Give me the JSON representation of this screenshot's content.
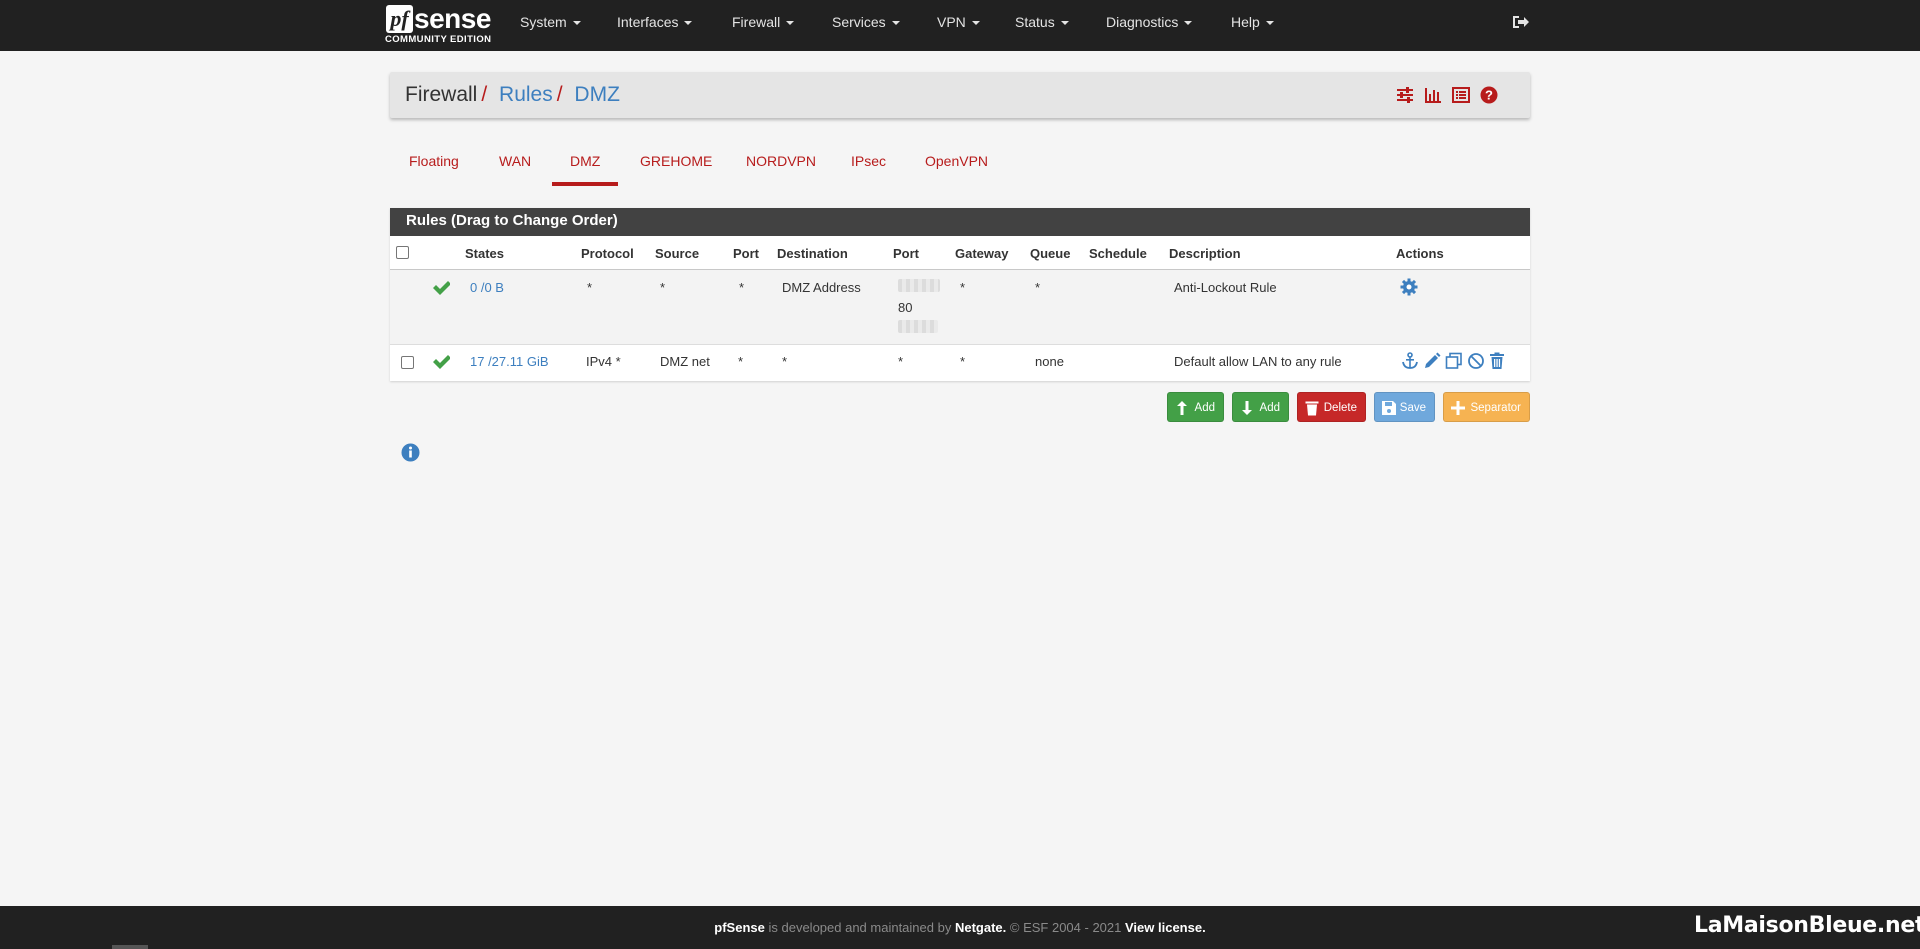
{
  "navbar": {
    "brand_pf": "pf",
    "brand_sense": "sense",
    "brand_edition": "COMMUNITY EDITION",
    "items": [
      {
        "label": "System"
      },
      {
        "label": "Interfaces"
      },
      {
        "label": "Firewall"
      },
      {
        "label": "Services"
      },
      {
        "label": "VPN"
      },
      {
        "label": "Status"
      },
      {
        "label": "Diagnostics"
      },
      {
        "label": "Help"
      }
    ],
    "logout_icon": "sign-out-icon"
  },
  "breadcrumb": {
    "items": [
      {
        "label": "Firewall",
        "link": false
      },
      {
        "label": "Rules",
        "link": true
      },
      {
        "label": "DMZ",
        "link": true
      }
    ],
    "separator": "/",
    "icons": [
      "sliders-icon",
      "bar-chart-icon",
      "list-icon",
      "help-icon"
    ]
  },
  "tabs": {
    "items": [
      "Floating",
      "WAN",
      "DMZ",
      "GREHOME",
      "NORDVPN",
      "IPsec",
      "OpenVPN"
    ],
    "active": "DMZ"
  },
  "rules": {
    "title": "Rules (Drag to Change Order)",
    "columns": [
      "States",
      "Protocol",
      "Source",
      "Port",
      "Destination",
      "Port",
      "Gateway",
      "Queue",
      "Schedule",
      "Description",
      "Actions"
    ],
    "rows": [
      {
        "states": "0 /0 B",
        "protocol": "*",
        "source": "*",
        "source_port": "*",
        "destination": "DMZ Address",
        "dest_port": "80",
        "gateway": "*",
        "queue": "*",
        "schedule": "",
        "description": "Anti-Lockout Rule",
        "actions": [
          "gear-icon"
        ]
      },
      {
        "states": "17 /27.11 GiB",
        "protocol": "IPv4 *",
        "source": "DMZ net",
        "source_port": "*",
        "destination": "*",
        "dest_port": "*",
        "gateway": "*",
        "queue": "none",
        "schedule": "",
        "description": "Default allow LAN to any rule",
        "actions": [
          "anchor-icon",
          "pencil-icon",
          "copy-icon",
          "ban-icon",
          "trash-icon"
        ]
      }
    ]
  },
  "buttons": {
    "add_top": "Add",
    "add_bottom": "Add",
    "delete": "Delete",
    "save": "Save",
    "separator": "Separator"
  },
  "colors": {
    "accent_red": "#b71c1c",
    "link_blue": "#3d7fbf",
    "navbar": "#212121",
    "green": "#43a047",
    "orange": "#f6b352"
  },
  "footer": {
    "brand": "pfSense",
    "text1": "is developed and maintained by",
    "company": "Netgate.",
    "copyright": "© ESF 2004 - 2021",
    "license": "View license."
  },
  "watermark": "LaMaisonBleue.net"
}
